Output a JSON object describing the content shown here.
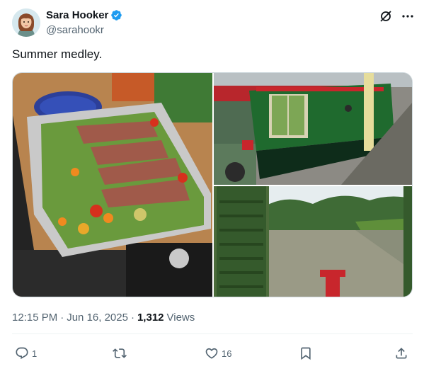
{
  "author": {
    "display_name": "Sara Hooker",
    "handle": "@sarahookr",
    "verified": true,
    "avatar_icon": "cartoon-avatar"
  },
  "post": {
    "text": "Summer medley.",
    "time": "12:15 PM",
    "separator": "·",
    "date": "Jun 16, 2025",
    "views_count": "1,312",
    "views_label": "Views"
  },
  "media": [
    {
      "description_icon": "photo-food-tray"
    },
    {
      "description_icon": "photo-narrowboat"
    },
    {
      "description_icon": "photo-canal"
    }
  ],
  "actions": {
    "reply_count": "1",
    "repost_count": "",
    "like_count": "16"
  },
  "colors": {
    "accent": "#1d9bf0",
    "text_secondary": "#536471",
    "text_primary": "#0f1419"
  }
}
